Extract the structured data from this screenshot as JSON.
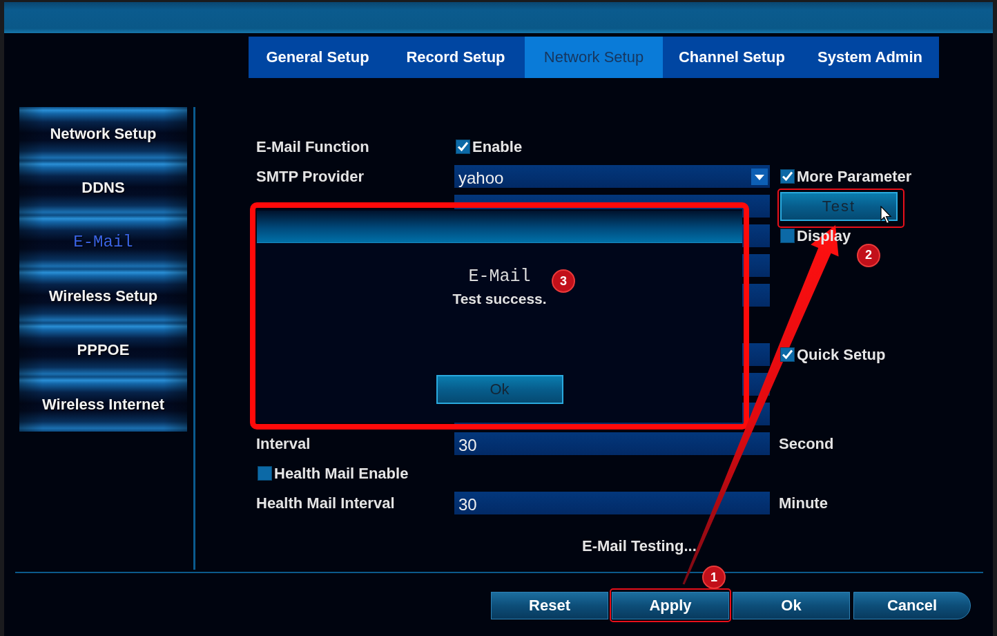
{
  "tabs": [
    {
      "label": "General Setup",
      "selected": false
    },
    {
      "label": "Record Setup",
      "selected": false
    },
    {
      "label": "Network Setup",
      "selected": true
    },
    {
      "label": "Channel Setup",
      "selected": false
    },
    {
      "label": "System Admin",
      "selected": false
    }
  ],
  "sidebar": {
    "items": [
      {
        "label": "Network Setup",
        "selected": false
      },
      {
        "label": "DDNS",
        "selected": false
      },
      {
        "label": "E-Mail",
        "selected": true
      },
      {
        "label": "Wireless Setup",
        "selected": false
      },
      {
        "label": "PPPOE",
        "selected": false
      },
      {
        "label": "Wireless Internet",
        "selected": false
      }
    ]
  },
  "form": {
    "rows": [
      {
        "kind": "option",
        "label": "E-Mail Function",
        "option": {
          "label": "Enable",
          "checked": true
        }
      },
      {
        "kind": "select",
        "label": "SMTP Provider",
        "value": "yahoo",
        "side": {
          "kind": "checkbox",
          "label": "More Parameter",
          "checked": true
        }
      },
      {
        "kind": "field",
        "side": {
          "kind": "button",
          "label": "Test",
          "highlighted": true,
          "step": "2",
          "hovered": true
        }
      },
      {
        "kind": "field",
        "side": {
          "kind": "checkbox",
          "label": "Display",
          "checked": false
        }
      },
      {
        "kind": "field"
      },
      {
        "kind": "field"
      },
      {
        "kind": "empty"
      },
      {
        "kind": "field",
        "side": {
          "kind": "checkbox",
          "label": "Quick Setup",
          "checked": true
        }
      },
      {
        "kind": "field"
      },
      {
        "kind": "field"
      },
      {
        "kind": "field",
        "label": "Interval",
        "value": "30",
        "side": {
          "kind": "unit",
          "label": "Second"
        }
      },
      {
        "kind": "checkbox",
        "option": {
          "label": "Health Mail Enable",
          "checked": false
        }
      },
      {
        "kind": "field",
        "label": "Health Mail Interval",
        "value": "30",
        "side": {
          "kind": "unit",
          "label": "Minute"
        }
      }
    ],
    "status": "E-Mail Testing..."
  },
  "buttons": [
    {
      "label": "Reset",
      "highlighted": false
    },
    {
      "label": "Apply",
      "highlighted": true,
      "step": "1"
    },
    {
      "label": "Ok",
      "highlighted": false
    },
    {
      "label": "Cancel",
      "highlighted": false
    }
  ],
  "dialog": {
    "title": "E-Mail",
    "message": "Test success.",
    "button": "Ok",
    "highlighted": true,
    "step": "3"
  },
  "annotation_arrow": true
}
